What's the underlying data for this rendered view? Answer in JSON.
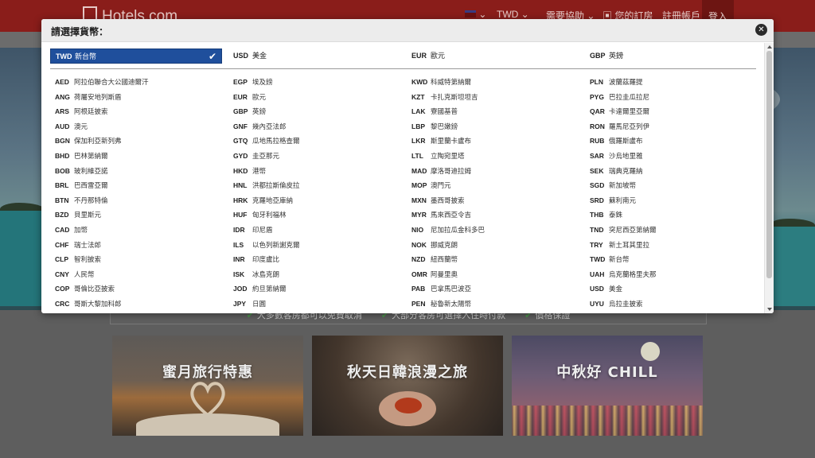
{
  "header": {
    "logo_text": "Hotels.com",
    "currency": "TWD",
    "help": "需要協助",
    "bookings": "您的訂房",
    "register": "註冊帳戶",
    "signin": "登入"
  },
  "perks": [
    {
      "text": "大多數客房都可以免費取消"
    },
    {
      "text": "大部分客房可選擇入住時付款"
    },
    {
      "text": "價格保證"
    }
  ],
  "cards": [
    {
      "title": "蜜月旅行特惠"
    },
    {
      "title": "秋天日韓浪漫之旅"
    },
    {
      "title": "中秋好 CHILL"
    }
  ],
  "modal": {
    "title": "請選擇貨幣：",
    "close_icon": "close-icon",
    "popular": [
      {
        "code": "TWD",
        "name": "新台幣",
        "selected": true
      },
      {
        "code": "USD",
        "name": "美金",
        "selected": false
      },
      {
        "code": "EUR",
        "name": "歐元",
        "selected": false
      },
      {
        "code": "GBP",
        "name": "英鎊",
        "selected": false
      }
    ],
    "columns": [
      [
        {
          "code": "AED",
          "name": "阿拉伯聯合大公國迪爾汗"
        },
        {
          "code": "ANG",
          "name": "荷屬安地列斯盾"
        },
        {
          "code": "ARS",
          "name": "阿根廷披索"
        },
        {
          "code": "AUD",
          "name": "澳元"
        },
        {
          "code": "BGN",
          "name": "保加利亞新列弗"
        },
        {
          "code": "BHD",
          "name": "巴林第納爾"
        },
        {
          "code": "BOB",
          "name": "玻利維亞諾"
        },
        {
          "code": "BRL",
          "name": "巴西雷亞爾"
        },
        {
          "code": "BTN",
          "name": "不丹那特倫"
        },
        {
          "code": "BZD",
          "name": "貝里斯元"
        },
        {
          "code": "CAD",
          "name": "加幣"
        },
        {
          "code": "CHF",
          "name": "瑞士法郎"
        },
        {
          "code": "CLP",
          "name": "智利披索"
        },
        {
          "code": "CNY",
          "name": "人民幣"
        },
        {
          "code": "COP",
          "name": "哥倫比亞披索"
        },
        {
          "code": "CRC",
          "name": "哥斯大黎加科郎"
        }
      ],
      [
        {
          "code": "EGP",
          "name": "埃及鎊"
        },
        {
          "code": "EUR",
          "name": "歐元"
        },
        {
          "code": "GBP",
          "name": "英鎊"
        },
        {
          "code": "GNF",
          "name": "幾內亞法郎"
        },
        {
          "code": "GTQ",
          "name": "瓜地馬拉格查爾"
        },
        {
          "code": "GYD",
          "name": "圭亞那元"
        },
        {
          "code": "HKD",
          "name": "港幣"
        },
        {
          "code": "HNL",
          "name": "洪都拉斯倫皮拉"
        },
        {
          "code": "HRK",
          "name": "克羅地亞庫納"
        },
        {
          "code": "HUF",
          "name": "匈牙利福林"
        },
        {
          "code": "IDR",
          "name": "印尼盾"
        },
        {
          "code": "ILS",
          "name": "以色列新謝克爾"
        },
        {
          "code": "INR",
          "name": "印度盧比"
        },
        {
          "code": "ISK",
          "name": "冰島克朗"
        },
        {
          "code": "JOD",
          "name": "約旦第納爾"
        },
        {
          "code": "JPY",
          "name": "日圓"
        }
      ],
      [
        {
          "code": "KWD",
          "name": "科威特第納爾"
        },
        {
          "code": "KZT",
          "name": "卡扎克斯坦坦吉"
        },
        {
          "code": "LAK",
          "name": "寮國基普"
        },
        {
          "code": "LBP",
          "name": "黎巴嫩鎊"
        },
        {
          "code": "LKR",
          "name": "斯里蘭卡盧布"
        },
        {
          "code": "LTL",
          "name": "立陶宛里塔"
        },
        {
          "code": "MAD",
          "name": "摩洛哥迪拉姆"
        },
        {
          "code": "MOP",
          "name": "澳門元"
        },
        {
          "code": "MXN",
          "name": "墨西哥披索"
        },
        {
          "code": "MYR",
          "name": "馬來西亞令吉"
        },
        {
          "code": "NIO",
          "name": "尼加拉瓜金科多巴"
        },
        {
          "code": "NOK",
          "name": "挪威克朗"
        },
        {
          "code": "NZD",
          "name": "紐西蘭幣"
        },
        {
          "code": "OMR",
          "name": "阿曼里奧"
        },
        {
          "code": "PAB",
          "name": "巴拿馬巴波亞"
        },
        {
          "code": "PEN",
          "name": "秘魯新太陽幣"
        }
      ],
      [
        {
          "code": "PLN",
          "name": "波蘭茲羅提"
        },
        {
          "code": "PYG",
          "name": "巴拉圭瓜拉尼"
        },
        {
          "code": "QAR",
          "name": "卡達爾里亞爾"
        },
        {
          "code": "RON",
          "name": "羅馬尼亞列伊"
        },
        {
          "code": "RUB",
          "name": "俄羅斯盧布"
        },
        {
          "code": "SAR",
          "name": "沙烏地里雅"
        },
        {
          "code": "SEK",
          "name": "瑞典克羅納"
        },
        {
          "code": "SGD",
          "name": "新加坡幣"
        },
        {
          "code": "SRD",
          "name": "蘇利南元"
        },
        {
          "code": "THB",
          "name": "泰銖"
        },
        {
          "code": "TND",
          "name": "突尼西亞第納爾"
        },
        {
          "code": "TRY",
          "name": "新土耳其里拉"
        },
        {
          "code": "TWD",
          "name": "新台幣"
        },
        {
          "code": "UAH",
          "name": "烏克蘭格里夫那"
        },
        {
          "code": "USD",
          "name": "美金"
        },
        {
          "code": "UYU",
          "name": "烏拉圭披索"
        }
      ]
    ]
  },
  "colors": {
    "brand_red": "#8a1d1a",
    "selected_blue": "#1f4f9c"
  }
}
